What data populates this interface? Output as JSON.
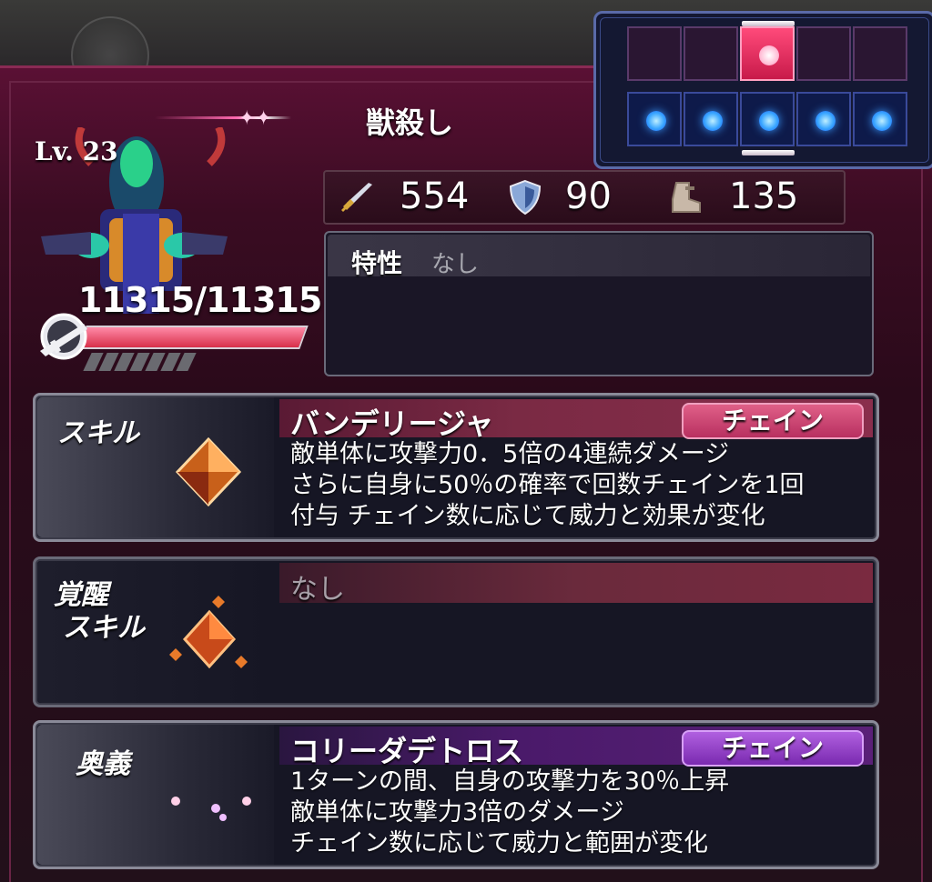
{
  "title": "獣殺し",
  "character": {
    "level": "Lv. 23",
    "hp": "11315/11315",
    "hp_fraction": 1.0,
    "sp_segments": 7
  },
  "formation": {
    "enemy_row": [
      false,
      false,
      true,
      false,
      false
    ],
    "ally_row": [
      true,
      true,
      true,
      true,
      true
    ]
  },
  "stats": {
    "attack": "554",
    "defense": "90",
    "speed": "135"
  },
  "trait": {
    "label": "特性",
    "value": "なし"
  },
  "skill": {
    "label": "スキル",
    "name": "バンデリージャ",
    "badge": "チェイン",
    "desc": [
      "敵単体に攻撃力0．5倍の4連続ダメージ",
      "さらに自身に50％の確率で回数チェインを1回",
      "付与 チェイン数に応じて威力と効果が変化"
    ]
  },
  "awaken": {
    "label_line1": "覚醒",
    "label_line2": "スキル",
    "value": "なし"
  },
  "ougi": {
    "label": "奥義",
    "name": "コリーダデトロス",
    "badge": "チェイン",
    "desc": [
      "1ターンの間、自身の攻撃力を30％上昇",
      "敵単体に攻撃力3倍のダメージ",
      "チェイン数に応じて威力と範囲が変化"
    ]
  },
  "colors": {
    "panel": "#3a0c22",
    "skill_head": "#7a2a44",
    "skill_badge": "#c8406a",
    "ougi_head": "#4a1a6a",
    "ougi_badge": "#8a3ac8"
  }
}
